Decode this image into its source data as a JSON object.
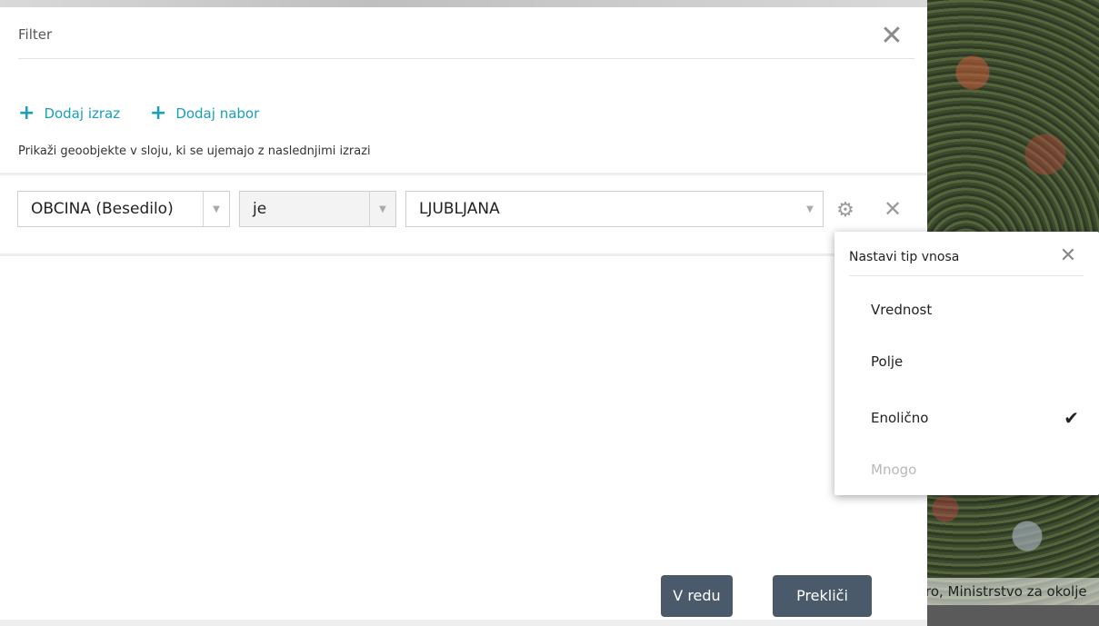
{
  "dialog": {
    "title": "Filter",
    "add_expression": "Dodaj izraz",
    "add_set": "Dodaj nabor",
    "description": "Prikaži geoobjekte v sloju, ki se ujemajo z naslednjimi izrazi"
  },
  "expression": {
    "field": "OBCINA (Besedilo)",
    "operator": "je",
    "value": "LJUBLJANA"
  },
  "buttons": {
    "ok": "V redu",
    "cancel": "Prekliči"
  },
  "input_type_popup": {
    "title": "Nastavi tip vnosa",
    "options": [
      {
        "label": "Vrednost",
        "selected": false,
        "disabled": false
      },
      {
        "label": "Polje",
        "selected": false,
        "disabled": false
      },
      {
        "label": "Enolično",
        "selected": true,
        "disabled": false
      },
      {
        "label": "Mnogo",
        "selected": false,
        "disabled": true
      }
    ]
  },
  "map": {
    "attribution": "ro, Ministrstvo za okolje"
  },
  "icons": {
    "plus": "plus-icon",
    "close": "close-icon",
    "gear": "gear-icon",
    "dropdown": "chevron-down-icon",
    "check": "check-icon"
  },
  "colors": {
    "accent": "#1a9fb8",
    "button_bg": "#4a5a6a"
  }
}
